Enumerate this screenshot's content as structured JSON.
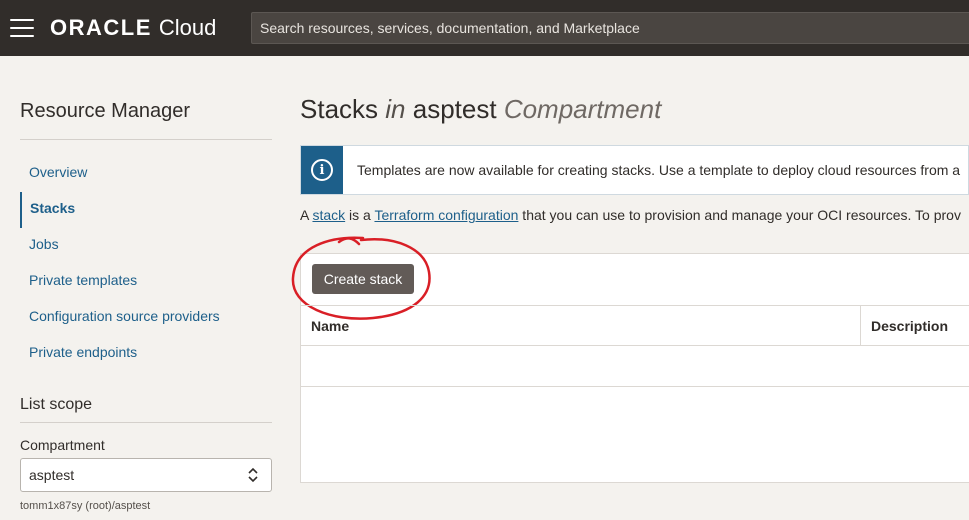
{
  "header": {
    "brand_oracle": "ORACLE",
    "brand_cloud": "Cloud",
    "search_placeholder": "Search resources, services, documentation, and Marketplace"
  },
  "sidebar": {
    "title": "Resource Manager",
    "items": [
      {
        "label": "Overview",
        "active": false
      },
      {
        "label": "Stacks",
        "active": true
      },
      {
        "label": "Jobs",
        "active": false
      },
      {
        "label": "Private templates",
        "active": false
      },
      {
        "label": "Configuration source providers",
        "active": false
      },
      {
        "label": "Private endpoints",
        "active": false
      }
    ],
    "scope_title": "List scope",
    "compartment_label": "Compartment",
    "compartment_value": "asptest",
    "compartment_path": "tomm1x87sy (root)/asptest"
  },
  "main": {
    "title_stacks": "Stacks",
    "title_in": "in",
    "title_compartment_name": "asptest",
    "title_compartment_word": "Compartment",
    "info_text": "Templates are now available for creating stacks. Use a template to deploy cloud resources from a",
    "desc_prefix": "A ",
    "desc_link1": "stack",
    "desc_middle": " is a ",
    "desc_link2": "Terraform configuration",
    "desc_suffix": " that you can use to provision and manage your OCI resources. To prov",
    "create_button": "Create stack",
    "table_headers": [
      "Name",
      "Description"
    ]
  },
  "colors": {
    "topbar": "#312d2a",
    "accent": "#1d5f8a",
    "button": "#625b57",
    "annotation": "#d91f26"
  }
}
